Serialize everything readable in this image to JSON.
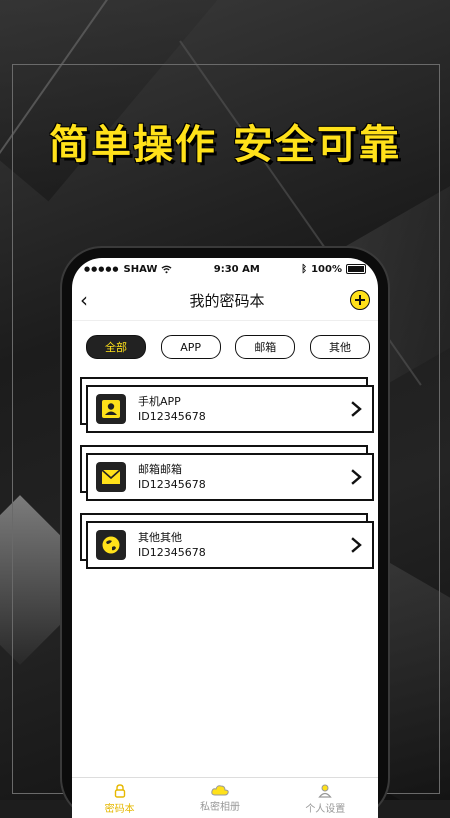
{
  "headline": "简单操作 安全可靠",
  "status": {
    "carrier": "SHAW",
    "time": "9:30 AM",
    "battery": "100%"
  },
  "nav": {
    "title": "我的密码本"
  },
  "filters": [
    {
      "label": "全部",
      "active": true
    },
    {
      "label": "APP",
      "active": false
    },
    {
      "label": "邮箱",
      "active": false
    },
    {
      "label": "其他",
      "active": false
    }
  ],
  "entries": [
    {
      "name": "手机APP",
      "id": "ID12345678",
      "icon": "user-icon"
    },
    {
      "name": "邮箱邮箱",
      "id": "ID12345678",
      "icon": "envelope-icon"
    },
    {
      "name": "其他其他",
      "id": "ID12345678",
      "icon": "globe-icon"
    }
  ],
  "tabs": [
    {
      "label": "密码本",
      "icon": "lock-icon",
      "active": true
    },
    {
      "label": "私密相册",
      "icon": "cloud-icon",
      "active": false
    },
    {
      "label": "个人设置",
      "icon": "person-icon",
      "active": false
    }
  ],
  "colors": {
    "accent": "#ffe11a",
    "dark": "#222222"
  }
}
